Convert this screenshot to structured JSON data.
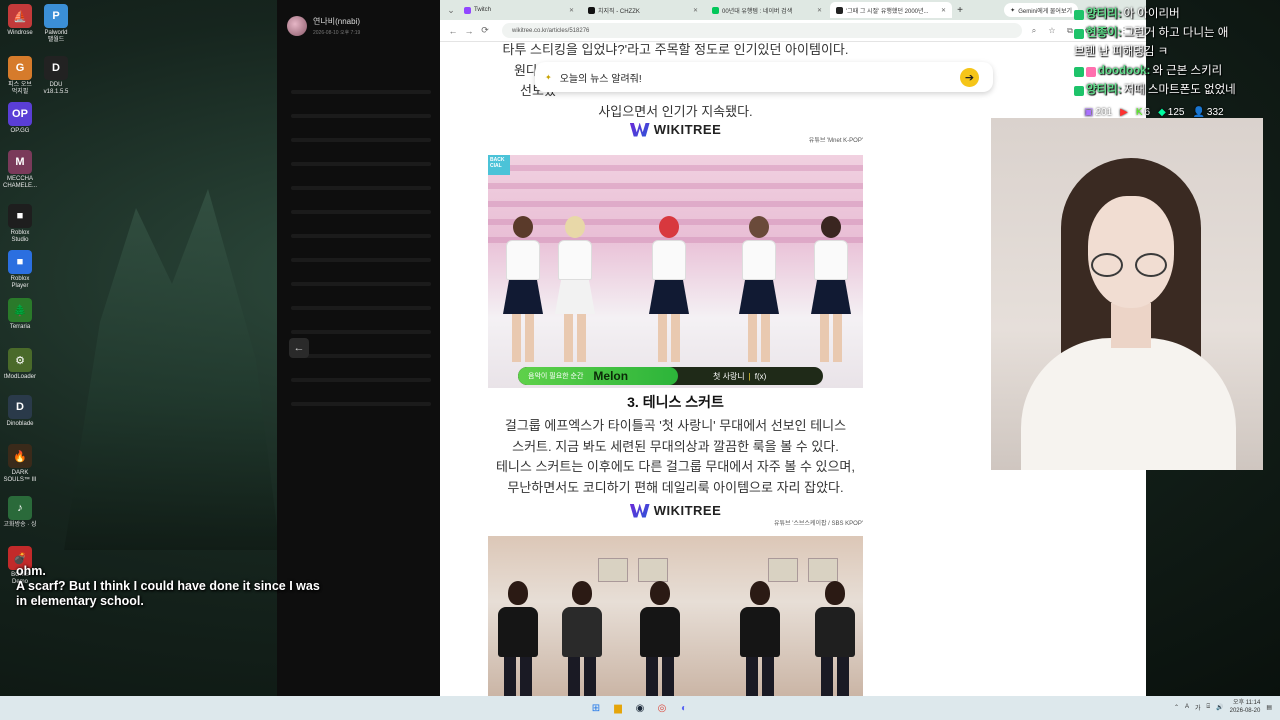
{
  "desktop": {
    "icons": [
      {
        "label": "Windrose",
        "icon": "windrose-icon",
        "color": "#c23a3a",
        "glyph": "⛵"
      },
      {
        "label": "Palworld\n팰월드",
        "icon": "palworld-icon",
        "color": "#3b8fd6",
        "glyph": "P"
      },
      {
        "label": "피스 오브\n먹지필",
        "icon": "game-icon",
        "color": "#d67b2b",
        "glyph": "G"
      },
      {
        "label": "DDU\nv18.1.5.5",
        "icon": "ddu-icon",
        "color": "#222222",
        "glyph": "D"
      },
      {
        "label": "OP.GG",
        "icon": "opgg-icon",
        "color": "#5a3ed6",
        "glyph": "OP"
      },
      {
        "label": "MECCHA\nCHAMELE...",
        "icon": "meccha-icon",
        "color": "#7a3a5a",
        "glyph": "M"
      },
      {
        "label": "Roblox\nStudio",
        "icon": "roblox-studio-icon",
        "color": "#1e1e1e",
        "glyph": "■"
      },
      {
        "label": "Roblox\nPlayer",
        "icon": "roblox-player-icon",
        "color": "#2b6fe0",
        "glyph": "■"
      },
      {
        "label": "Terraria",
        "icon": "terraria-icon",
        "color": "#2a7a2a",
        "glyph": "🌲"
      },
      {
        "label": "tModLoader",
        "icon": "tmodloader-icon",
        "color": "#4a6a2a",
        "glyph": "⚙"
      },
      {
        "label": "Dinoblade",
        "icon": "dinoblade-icon",
        "color": "#2a3a4a",
        "glyph": "D"
      },
      {
        "label": "DARK\nSOULS™ III",
        "icon": "darksouls-icon",
        "color": "#3a2a1a",
        "glyph": "🔥"
      },
      {
        "label": "고화방송 · 싱",
        "icon": "app-icon",
        "color": "#2a6a3a",
        "glyph": "♪"
      },
      {
        "label": "BOMB\nDemo",
        "icon": "bomb-icon",
        "color": "#c22a2a",
        "glyph": "💣"
      }
    ]
  },
  "side_app": {
    "user_name": "연나비(nnabi)",
    "date": "2026-08-10 오후 7:19"
  },
  "browser": {
    "tabs": [
      {
        "title": "Twitch",
        "color": "#9146ff"
      },
      {
        "title": "치지직 - CHZZK",
        "color": "#111111"
      },
      {
        "title": "00년대 유행템 : 네이버 검색",
        "color": "#03c75a"
      },
      {
        "title": "'그때 그 시절' 유행했던 2000년...",
        "color": "#222222"
      }
    ],
    "gemini_button": "Gemini에게 물어보기",
    "url": "wikitree.co.kr/articles/518276"
  },
  "gemini_prompt": {
    "text": "오늘의 뉴스 알려줘!"
  },
  "article": {
    "top_lines": [
      "타투 스티킹을 입었냐?'라고 주목할 정도로 인기있던 아이템이다.",
      "원다",
      "선보였",
      "사입으면서 인기가 지속됐다."
    ],
    "brand": "WIKITREE",
    "credit1": "유튜브 'Mnet K-POP'",
    "image1_badge": "BACK\nCIAL",
    "melon_tagline": "음악이 필요한 순간",
    "melon_logo": "Melon",
    "song_title": "첫 사랑니",
    "artist": "f(x)",
    "section_title": "3. 테니스 스커트",
    "body_lines": [
      "걸그룹 에프엑스가 타이틀곡 '첫 사랑니' 무대에서 선보인 테니스",
      "스커트. 지금 봐도 세련된 무대의상과 깔끔한 룩을 볼 수 있다.",
      "테니스 스커트는 이후에도 다른 걸그룹 무대에서 자주 볼 수 있으며,",
      "무난하면서도 코디하기 편해 데일리룩 아이템으로 자리 잡았다."
    ],
    "credit2": "유튜브 '스브스케이팝 / SBS KPOP'"
  },
  "chat": {
    "lines": [
      {
        "user": "양티리:",
        "text": "아 아이리버"
      },
      {
        "user": "현종이:",
        "text": "그런거 하고 다니는 애"
      },
      {
        "user": "",
        "text": "브렌 난 피해댕김 ㅋ"
      },
      {
        "user": "doodook:",
        "text": "와 근본 스키리"
      },
      {
        "user": "양티리:",
        "text": "저때 스마트폰도 없었네"
      }
    ],
    "stats": {
      "a": "201",
      "b": "6",
      "c": "125",
      "viewers": "332"
    }
  },
  "subtitles": {
    "line1": "ohm.",
    "line2": "A scarf? But I think I could have done it since I was in elementary school."
  },
  "taskbar": {
    "time": "오후 11:14",
    "date": "2026-08-20"
  }
}
